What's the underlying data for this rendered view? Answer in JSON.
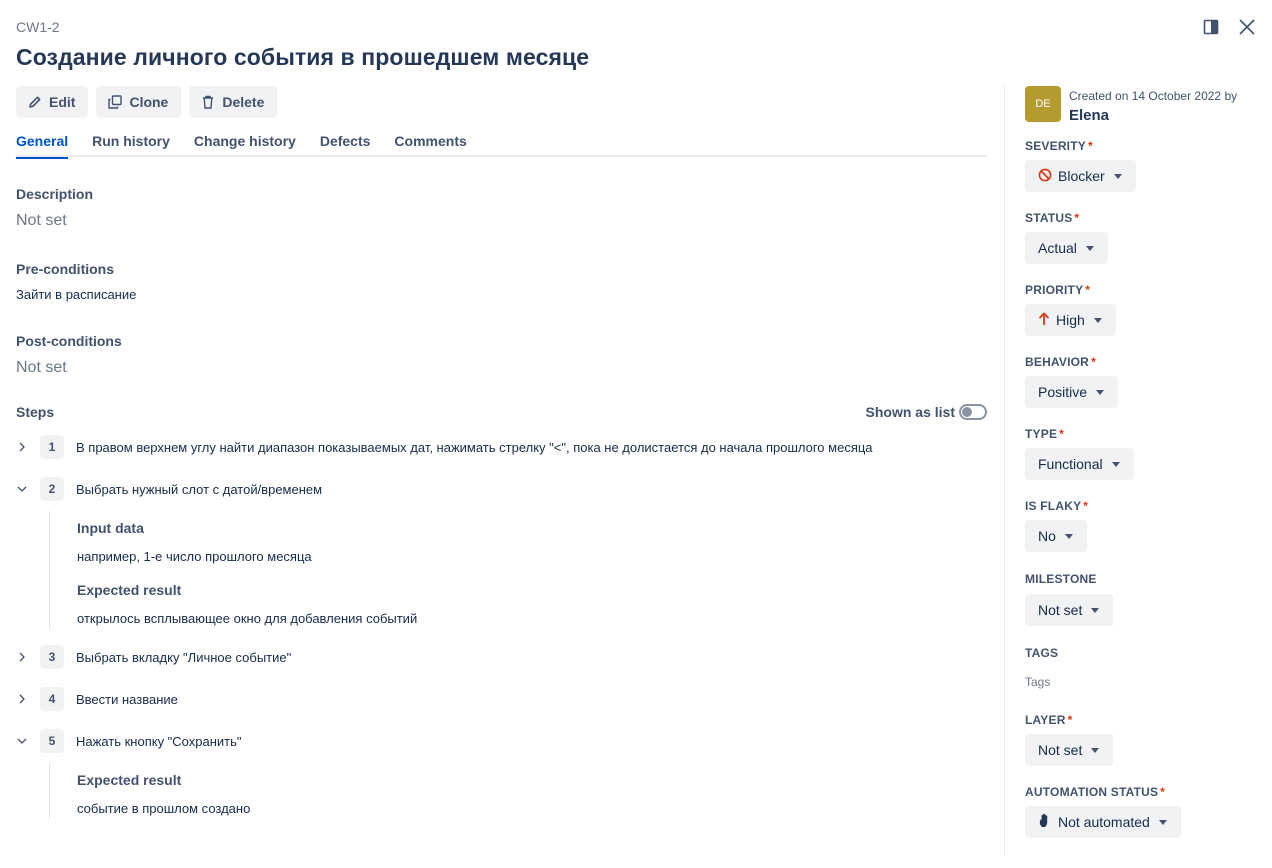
{
  "header": {
    "case_id": "CW1-2",
    "title": "Создание личного события в прошедшем месяце"
  },
  "icons": {
    "panel": "panel-icon",
    "close": "close-icon"
  },
  "toolbar": {
    "edit_label": "Edit",
    "clone_label": "Clone",
    "delete_label": "Delete"
  },
  "tabs": [
    {
      "label": "General",
      "active": true
    },
    {
      "label": "Run history"
    },
    {
      "label": "Change history"
    },
    {
      "label": "Defects"
    },
    {
      "label": "Comments"
    }
  ],
  "general": {
    "description_label": "Description",
    "description_value": "Not set",
    "preconditions_label": "Pre-conditions",
    "preconditions_value": "Зайти в расписание",
    "postconditions_label": "Post-conditions",
    "postconditions_value": "Not set",
    "steps_label": "Steps",
    "shown_as_list_label": "Shown as list"
  },
  "steps": [
    {
      "number": "1",
      "text": "В правом верхнем углу найти диапазон показываемых дат, нажимать стрелку \"<\", пока не долистается до начала прошлого месяца",
      "expanded": false
    },
    {
      "number": "2",
      "text": "Выбрать нужный слот с датой/временем",
      "expanded": true,
      "input_data_label": "Input data",
      "input_data": "например, 1-е число прошлого месяца",
      "expected_label": "Expected result",
      "expected": "открылось всплывающее окно для добавления событий"
    },
    {
      "number": "3",
      "text": "Выбрать вкладку \"Личное событие\"",
      "expanded": false
    },
    {
      "number": "4",
      "text": "Ввести название",
      "expanded": false
    },
    {
      "number": "5",
      "text": "Нажать кнопку \"Сохранить\"",
      "expanded": true,
      "expected_label": "Expected result",
      "expected": "событие в прошлом создано"
    }
  ],
  "sidebar": {
    "avatar_initials": "DE",
    "created_text": "Created on 14 October 2022 by",
    "author": "Elena",
    "severity_label": "SEVERITY",
    "severity_value": "Blocker",
    "status_label": "STATUS",
    "status_value": "Actual",
    "priority_label": "PRIORITY",
    "priority_value": "High",
    "behavior_label": "BEHAVIOR",
    "behavior_value": "Positive",
    "type_label": "TYPE",
    "type_value": "Functional",
    "flaky_label": "IS FLAKY",
    "flaky_value": "No",
    "milestone_label": "MILESTONE",
    "milestone_value": "Not set",
    "tags_label": "TAGS",
    "tags_placeholder": "Tags",
    "layer_label": "LAYER",
    "layer_value": "Not set",
    "automation_label": "AUTOMATION STATUS",
    "automation_value": "Not automated",
    "required_mark": "*"
  },
  "colors": {
    "accent": "#0052cc",
    "blocker": "#de350b",
    "high": "#de350b",
    "avatar": "#b49a2f"
  }
}
